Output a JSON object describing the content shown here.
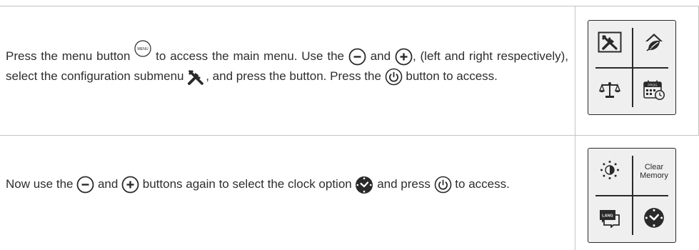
{
  "rows": [
    {
      "parts": [
        "Press the menu button ",
        " to access the main menu. Use the ",
        " and ",
        ", (left and right respectively), select the configuration submenu ",
        ", and press the button.  Press the ",
        " button to access."
      ]
    },
    {
      "parts": [
        "Now use the ",
        " and ",
        " buttons again to select the clock option ",
        " and press ",
        " to access."
      ]
    }
  ],
  "icons": {
    "menu_button_label": "MENU",
    "prog_label": "PROG",
    "lang_label": "LANG"
  },
  "panel2": {
    "clear_memory_line1": "Clear",
    "clear_memory_line2": "Memory"
  }
}
